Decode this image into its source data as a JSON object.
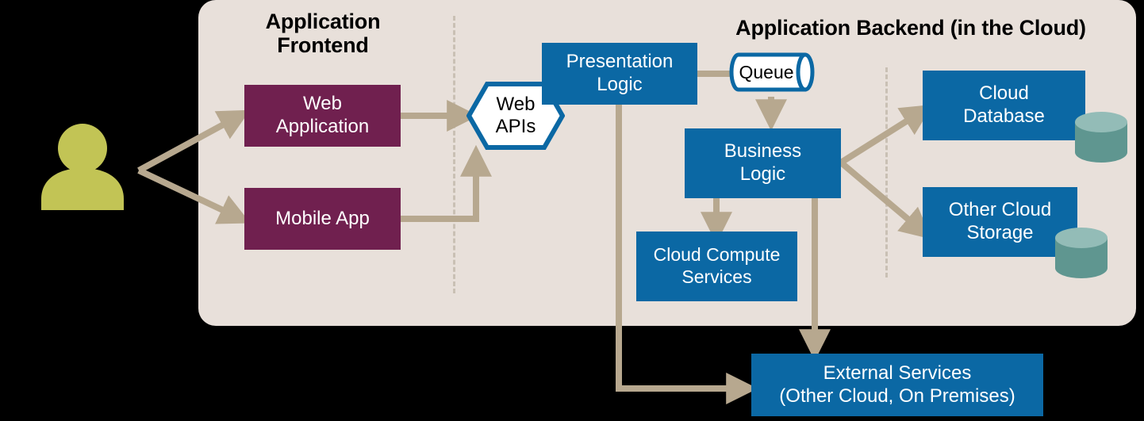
{
  "diagram": {
    "title_frontend": "Application\nFrontend",
    "title_backend": "Application Backend (in the Cloud)",
    "colors": {
      "panel": "#e8e0da",
      "blue": "#0b68a4",
      "maroon": "#70204f",
      "arrow": "#b7a88f",
      "cylinder": "#5f9690",
      "cylinder_top": "#93bcb7",
      "user": "#c2c455",
      "background": "#000000",
      "divider": "#c9c0b4"
    },
    "nodes": {
      "web_application": "Web\nApplication",
      "mobile_app": "Mobile App",
      "web_apis": "Web\nAPIs",
      "presentation_logic": "Presentation\nLogic",
      "queue": "Queue",
      "business_logic": "Business\nLogic",
      "cloud_compute_services": "Cloud Compute\nServices",
      "cloud_database": "Cloud\nDatabase",
      "other_cloud_storage": "Other Cloud\nStorage",
      "external_services": "External  Services\n(Other Cloud, On Premises)"
    },
    "icons": {
      "user": "user-icon",
      "database_1": "database-cylinder-icon",
      "database_2": "database-cylinder-icon"
    }
  }
}
